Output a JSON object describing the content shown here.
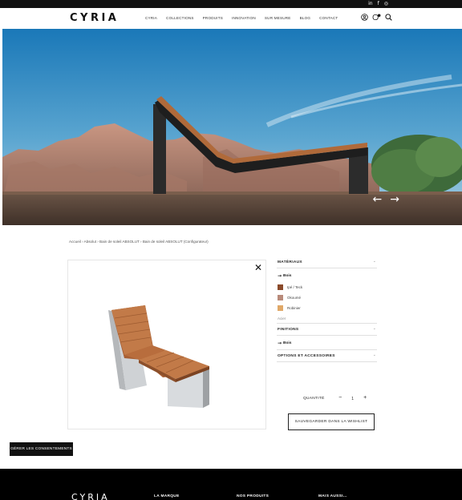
{
  "topbar": {
    "social": [
      {
        "icon": "linkedin-icon",
        "glyph": "in"
      },
      {
        "icon": "facebook-icon",
        "glyph": "f"
      },
      {
        "icon": "instagram-icon",
        "glyph": "◎"
      }
    ]
  },
  "header": {
    "logo": "CYRIA",
    "nav": [
      "CYRIA",
      "COLLECTIONS",
      "PRODUITS",
      "INNOVATION",
      "SUR MESURE",
      "BLOG",
      "CONTACT"
    ],
    "icons": [
      "user-icon",
      "cart-icon",
      "search-icon"
    ],
    "cart_count": ""
  },
  "hero": {
    "prev": "←",
    "next": "→"
  },
  "breadcrumb": "Accueil › Absolut › Bain de soleil ABSOLUT › Bain de soleil ABSOLUT (Configurateur)",
  "product": {
    "close": "✕"
  },
  "options": {
    "materials": {
      "title": "MATÉRIAUX",
      "sub": "Bois",
      "swatches": [
        {
          "label": "Ipé / Teck",
          "color": "#8a4a2a"
        },
        {
          "label": "Okoumé",
          "color": "#b88a7a"
        },
        {
          "label": "Robinier",
          "color": "#e0a868"
        }
      ],
      "extra": "Acier"
    },
    "finitions": {
      "title": "FINITIONS",
      "sub": "Bois"
    },
    "accessoires": {
      "title": "OPTIONS ET ACCESSOIRES"
    }
  },
  "quantity": {
    "label": "QUANTITÉ",
    "minus": "−",
    "value": "1",
    "plus": "+"
  },
  "wishlist_label": "SAUVEGARDER DANS LA WISHLIST",
  "consent_label": "GÉRER LES CONSENTEMENTS",
  "footer": {
    "logo": "CYRIA",
    "cols": [
      "LA MARQUE",
      "NOS PRODUITS",
      "MAIS AUSSI..."
    ]
  },
  "colors": {
    "accent": "#111111",
    "wood": "#b06a3a",
    "sky_top": "#1f7fc0",
    "sky_bottom": "#9ec8e0"
  }
}
